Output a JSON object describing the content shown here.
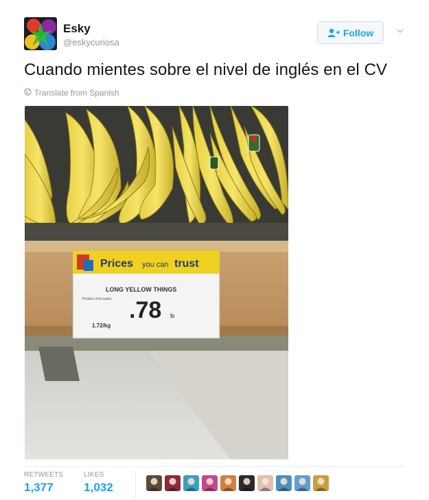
{
  "author": {
    "name": "Esky",
    "handle": "@eskycuriosa"
  },
  "follow": {
    "label": "Follow"
  },
  "tweet": {
    "text": "Cuando mientes sobre el nivel de inglés en el CV"
  },
  "translate": {
    "label": "Translate from Spanish"
  },
  "photo": {
    "sign_brand_a": "Prices",
    "sign_brand_b": "you can",
    "sign_brand_c": "trust",
    "product": "LONG YELLOW THINGS",
    "origin": "Product of Ecuador",
    "price": ".78",
    "unit": "lb",
    "price_kg": "1.72/kg"
  },
  "stats": {
    "retweets_label": "RETWEETS",
    "retweets": "1,377",
    "likes_label": "LIKES",
    "likes": "1,032"
  },
  "likers": [
    "#5a4a3a",
    "#8a2a3a",
    "#3aa0c0",
    "#c04a8a",
    "#d08040",
    "#2a2a2a",
    "#e0c0b0",
    "#4a90c0",
    "#60a0d0",
    "#c8a040"
  ],
  "colors": {
    "accent": "#1da1f2",
    "muted": "#8899a6",
    "text": "#14171a"
  }
}
